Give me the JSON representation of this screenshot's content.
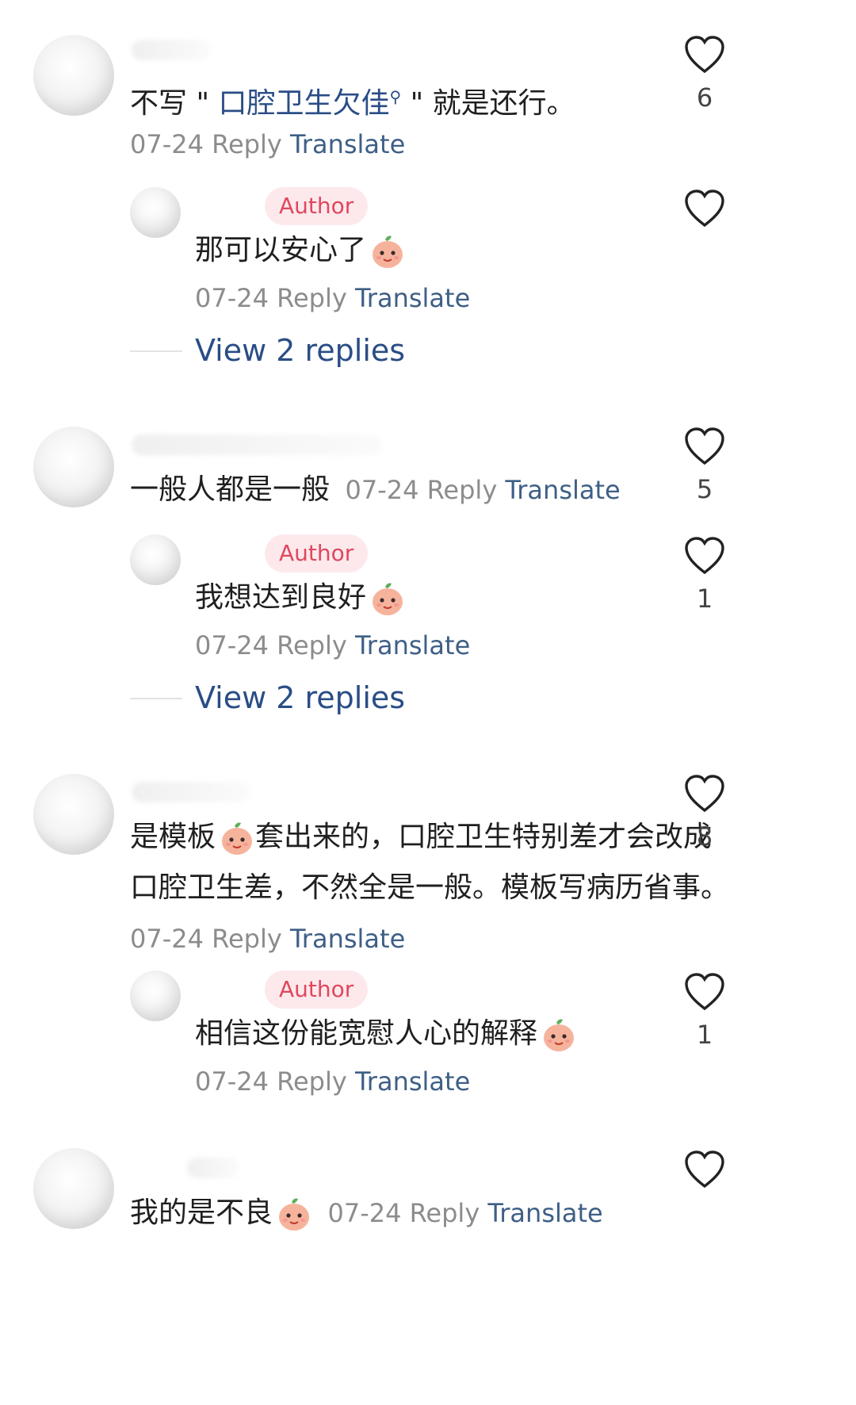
{
  "comments": [
    {
      "text_pre": "不写 \"",
      "text_link": "口腔卫生欠佳",
      "text_post": "\" 就是还行。",
      "date": "07-24",
      "reply": "Reply",
      "translate": "Translate",
      "likes": "6",
      "replies": [
        {
          "badge": "Author",
          "text": "那可以安心了",
          "date": "07-24",
          "reply": "Reply",
          "translate": "Translate"
        }
      ],
      "view_replies": "View 2 replies"
    },
    {
      "text": "一般人都是一般",
      "date": "07-24",
      "reply": "Reply",
      "translate": "Translate",
      "likes": "5",
      "replies": [
        {
          "badge": "Author",
          "text": "我想达到良好",
          "date": "07-24",
          "reply": "Reply",
          "translate": "Translate",
          "likes": "1"
        }
      ],
      "view_replies": "View 2 replies"
    },
    {
      "text_a": "是模板",
      "text_b": "套出来的，口腔卫生特别差才会改成口腔卫生差，不然全是一般。模板写病历省事。",
      "date": "07-24",
      "reply": "Reply",
      "translate": "Translate",
      "likes": "8",
      "replies": [
        {
          "badge": "Author",
          "text": "相信这份能宽慰人心的解释",
          "date": "07-24",
          "reply": "Reply",
          "translate": "Translate",
          "likes": "1"
        }
      ]
    },
    {
      "text": "我的是不良",
      "date": "07-24",
      "reply": "Reply",
      "translate": "Translate"
    }
  ],
  "icons": {
    "like": "heart-outline-icon",
    "search": "search-icon"
  }
}
